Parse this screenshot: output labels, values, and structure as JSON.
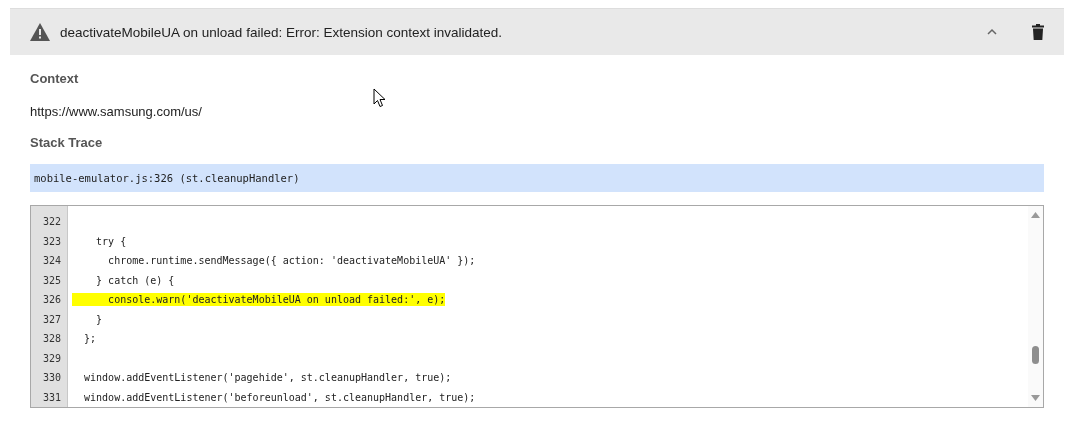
{
  "error": {
    "message": "deactivateMobileUA on unload failed: Error: Extension context invalidated.",
    "expanded": true
  },
  "context": {
    "heading": "Context",
    "url": "https://www.samsung.com/us/"
  },
  "stack_trace": {
    "heading": "Stack Trace",
    "frames": [
      {
        "label": "mobile-emulator.js:326 (st.cleanupHandler)",
        "selected": true
      }
    ]
  },
  "code": {
    "lines": [
      {
        "number": "322",
        "highlighted": false
      },
      {
        "number": "323",
        "text": "    try {",
        "highlighted": false
      },
      {
        "number": "324",
        "text": "      chrome.runtime.sendMessage({ action: 'deactivateMobileUA' });",
        "highlighted": false
      },
      {
        "number": "325",
        "text": "    } catch (e) {",
        "highlighted": false
      },
      {
        "number": "326",
        "text": "      console.warn('deactivateMobileUA on unload failed:', e);",
        "highlighted": true
      },
      {
        "number": "327",
        "text": "    }",
        "highlighted": false
      },
      {
        "number": "328",
        "text": "  };",
        "highlighted": false
      },
      {
        "number": "329",
        "highlighted": false
      },
      {
        "number": "330",
        "text": "  window.addEventListener('pagehide', st.cleanupHandler, true);",
        "highlighted": false
      },
      {
        "number": "331",
        "text": "  window.addEventListener('beforeunload', st.cleanupHandler, true);",
        "highlighted": false
      }
    ]
  }
}
